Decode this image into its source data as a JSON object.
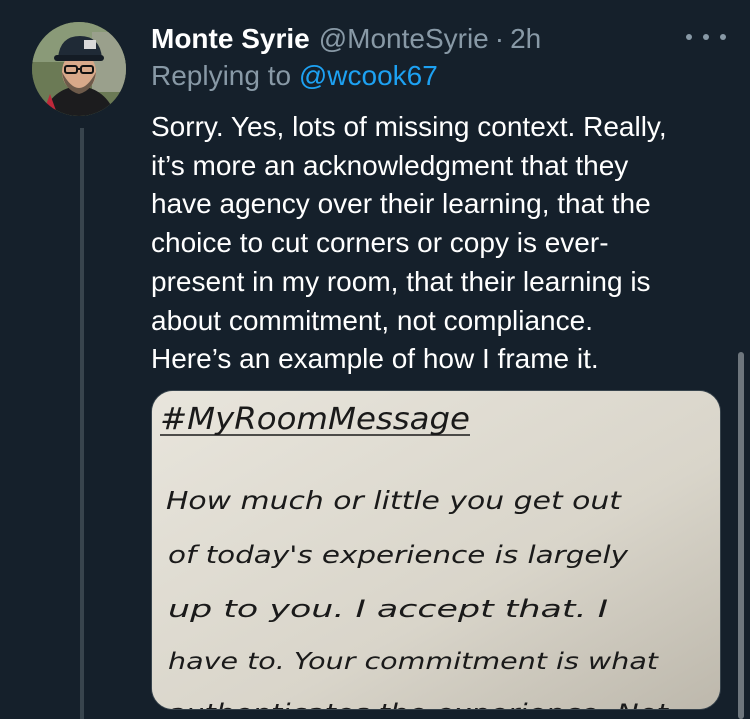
{
  "tweet": {
    "display_name": "Monte Syrie",
    "handle": "@MonteSyrie",
    "separator": "·",
    "time": "2h",
    "replying_prefix": "Replying to ",
    "replying_to": "@wcook67",
    "text_lines": [
      "Sorry. Yes, lots of missing context. Really,",
      "it’s more an acknowledgment that they",
      "have agency over their learning, that the",
      "choice to cut corners or copy is ever-",
      "present in my room, that their learning is",
      "about commitment, not compliance.",
      "Here’s an example of how I frame it."
    ],
    "more_icon": "more-horizontal-icon"
  },
  "media": {
    "handwritten_lines": [
      "#MyRoomMessage",
      "How much or little you get out",
      "of today's experience is largely",
      "up to you. I accept that. I",
      "have to. Your commitment is what",
      "authenticates the experience. Not"
    ]
  },
  "colors": {
    "background": "#15202b",
    "primary_text": "#ffffff",
    "secondary_text": "#8899a6",
    "link": "#1da1f2",
    "divider": "#38444d"
  }
}
